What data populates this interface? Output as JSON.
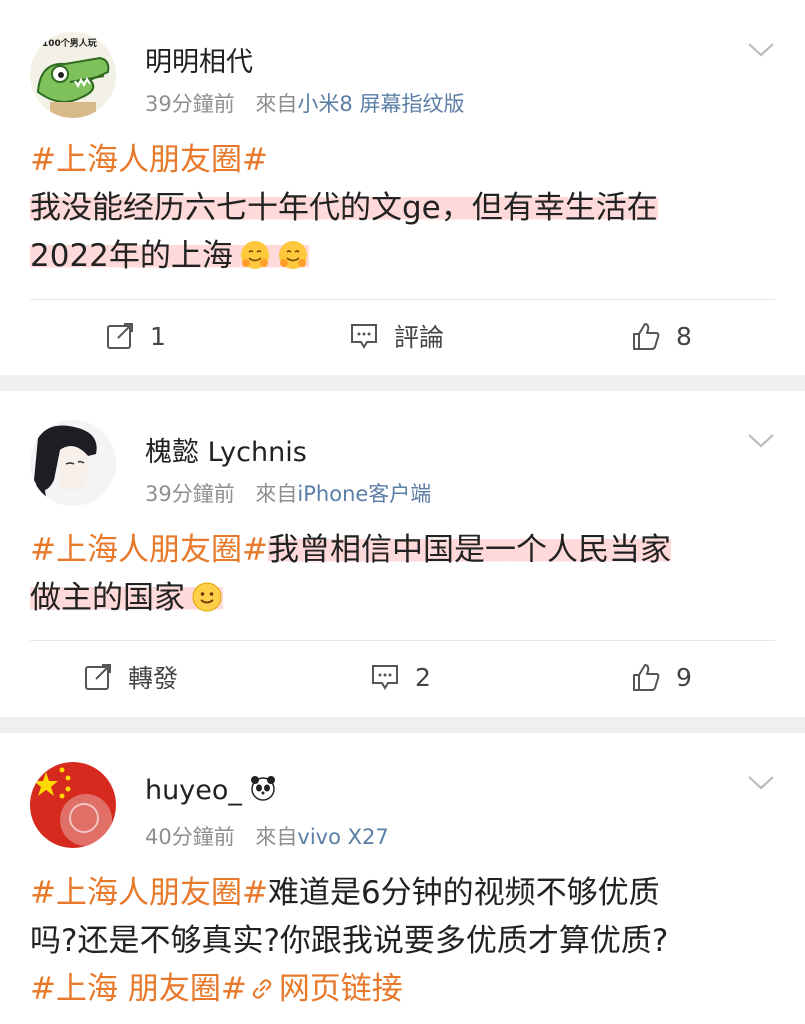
{
  "posts": [
    {
      "name": "明明相代",
      "avatar_label": "100个男人玩",
      "time": "39分鐘前",
      "from_prefix": "來自",
      "source": "小米8 屏幕指纹版",
      "tag": "#上海人朋友圈#",
      "text_line1": "我没能经历六七十年代的文ge，但有幸生活在",
      "text_line2": "2022年的上海",
      "emoji": [
        "hugging-face-emoji",
        "hugging-face-emoji"
      ],
      "actions": {
        "repost": "1",
        "comment": "評論",
        "like": "8"
      }
    },
    {
      "name": "槐懿 Lychnis",
      "time": "39分鐘前",
      "from_prefix": "來自",
      "source": "iPhone客户端",
      "tag": "#上海人朋友圈#",
      "text_line1": "我曾相信中国是一个人民当家",
      "text_line2": "做主的国家",
      "emoji": [
        "smile-emoji"
      ],
      "actions": {
        "repost": "轉發",
        "comment": "2",
        "like": "9"
      }
    },
    {
      "name": "huyeo_",
      "name_icon": "panda-icon",
      "time": "40分鐘前",
      "from_prefix": "來自",
      "source": "vivo X27",
      "tag": "#上海人朋友圈#",
      "text_line1": "难道是6分钟的视频不够优质",
      "text_line2": "吗?还是不够真实?你跟我说要多优质才算优质?",
      "tag2": "#上海 朋友圈#",
      "link_icon": "link-icon",
      "link_text": "网页链接"
    }
  ],
  "colors": {
    "tag": "#e8782a",
    "source": "#5a7ea6",
    "meta": "#8f8f8f",
    "highlight": "#ffb3b3"
  }
}
